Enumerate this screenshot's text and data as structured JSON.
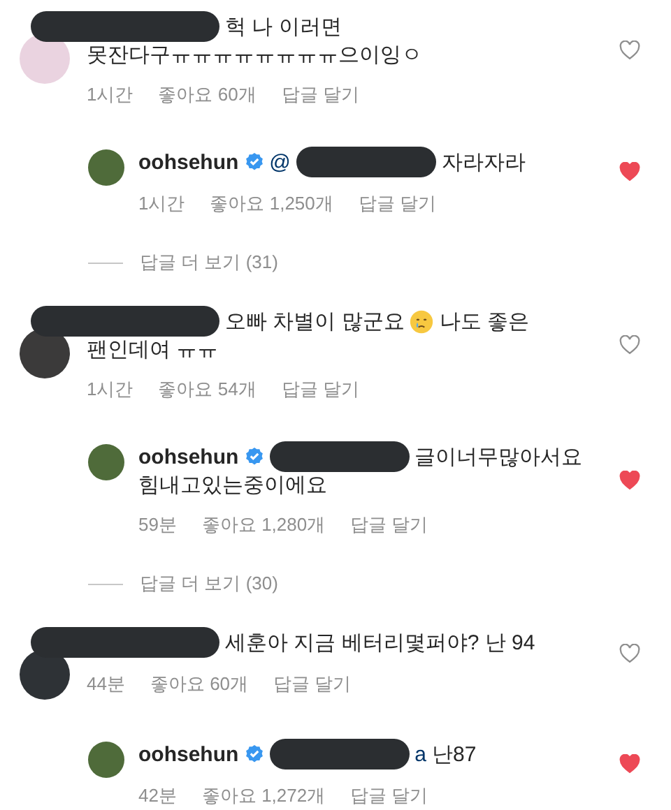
{
  "items": [
    {
      "kind": "comment",
      "color": "#ead3e0",
      "liked": false,
      "lines": [
        [
          {
            "kind": "redaction"
          },
          {
            "kind": "text",
            "text": "헉 나 이러면"
          }
        ],
        [
          {
            "kind": "text",
            "text": "못잔다구ㅠㅠㅠㅠㅠㅠㅠㅠ으이잉ㅇ"
          }
        ]
      ],
      "time": "1시간",
      "likes": "좋아요 60개",
      "reply": "답글 달기"
    },
    {
      "kind": "reply",
      "color": "#4f6b3a",
      "liked": true,
      "lines": [
        [
          {
            "kind": "user",
            "text": "oohsehun"
          },
          {
            "kind": "verified"
          },
          {
            "kind": "mention",
            "text": "@"
          },
          {
            "kind": "redaction"
          },
          {
            "kind": "text",
            "text": "자라자라"
          }
        ]
      ],
      "time": "1시간",
      "likes": "좋아요 1,250개",
      "reply": "답글 달기"
    },
    {
      "kind": "more",
      "text": "답글 더 보기 (31)"
    },
    {
      "kind": "comment",
      "color": "#3b3a3a",
      "liked": false,
      "lines": [
        [
          {
            "kind": "redaction"
          },
          {
            "kind": "text",
            "text": "오빠 차별이 많군요"
          },
          {
            "kind": "emoji"
          },
          {
            "kind": "text",
            "text": "나도 좋은"
          }
        ],
        [
          {
            "kind": "text",
            "text": "팬인데여 ㅠㅠ"
          }
        ]
      ],
      "time": "1시간",
      "likes": "좋아요 54개",
      "reply": "답글 달기"
    },
    {
      "kind": "reply",
      "color": "#4f6b3a",
      "liked": true,
      "lines": [
        [
          {
            "kind": "user",
            "text": "oohsehun"
          },
          {
            "kind": "verified"
          },
          {
            "kind": "redaction"
          },
          {
            "kind": "text",
            "text": "글이너무많아서요"
          }
        ],
        [
          {
            "kind": "text",
            "text": "힘내고있는중이에요"
          }
        ]
      ],
      "time": "59분",
      "likes": "좋아요 1,280개",
      "reply": "답글 달기"
    },
    {
      "kind": "more",
      "text": "답글 더 보기 (30)"
    },
    {
      "kind": "comment",
      "color": "#2e3236",
      "liked": false,
      "lines": [
        [
          {
            "kind": "redaction"
          },
          {
            "kind": "text",
            "text": "세훈아 지금 베터리몇퍼야? 난 94"
          }
        ]
      ],
      "time": "44분",
      "likes": "좋아요 60개",
      "reply": "답글 달기"
    },
    {
      "kind": "reply",
      "color": "#4f6b3a",
      "liked": true,
      "lines": [
        [
          {
            "kind": "user",
            "text": "oohsehun"
          },
          {
            "kind": "verified"
          },
          {
            "kind": "redaction"
          },
          {
            "kind": "mention",
            "text": "a"
          },
          {
            "kind": "text",
            "text": "난87"
          }
        ]
      ],
      "time": "42분",
      "likes": "좋아요 1,272개",
      "reply": "답글 달기"
    }
  ]
}
